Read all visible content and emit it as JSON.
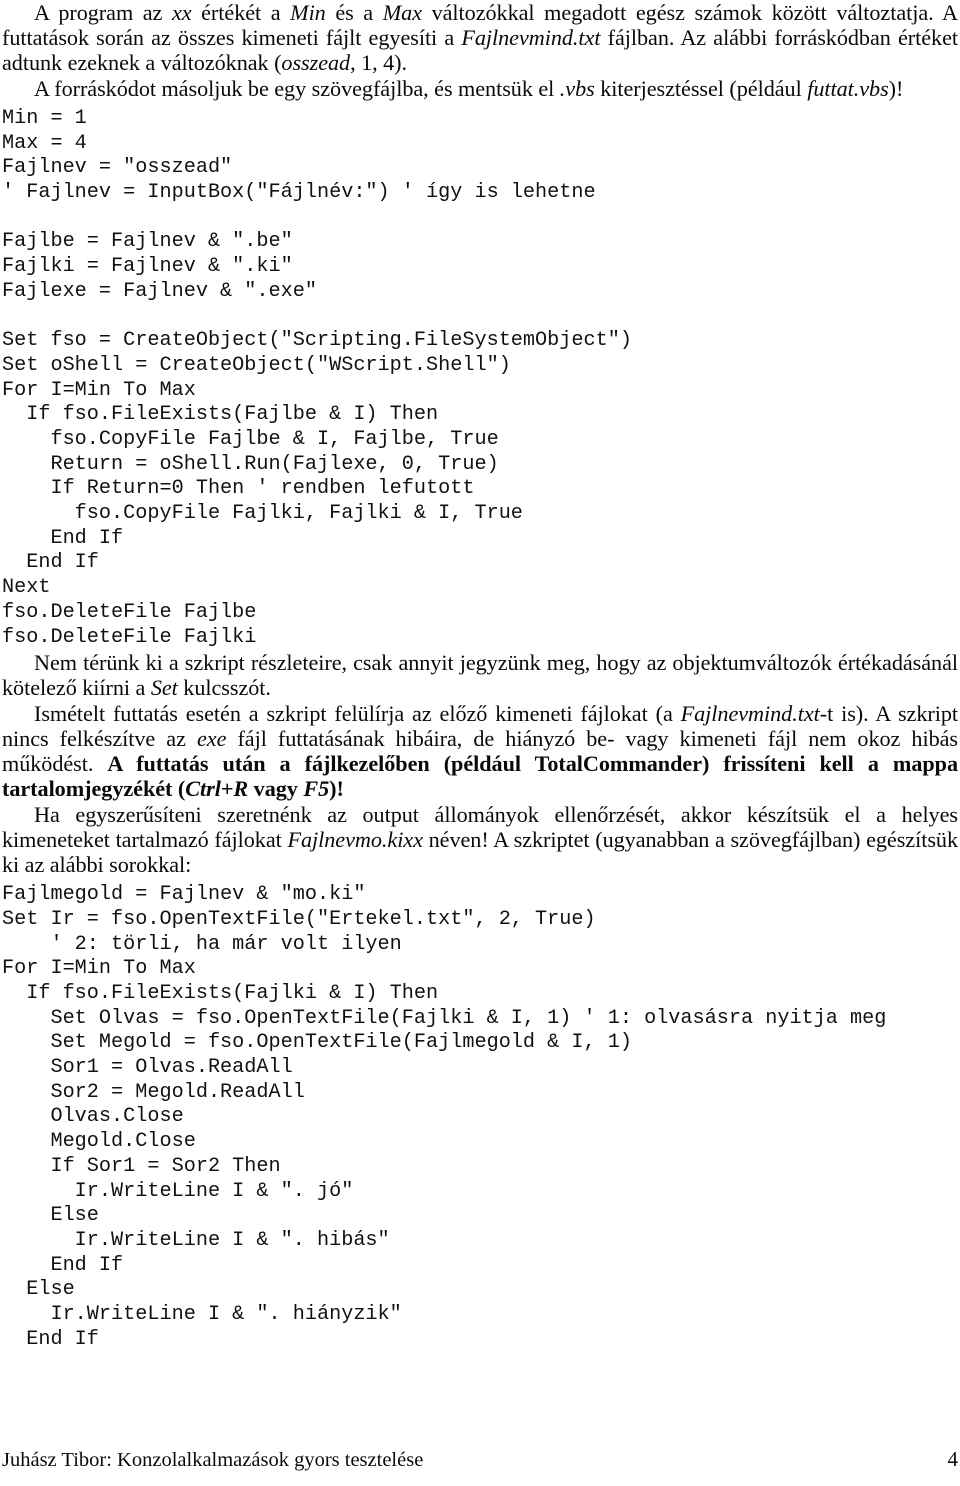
{
  "document": {
    "language": "hu",
    "paragraphs": {
      "intro": {
        "segments": [
          {
            "text": "A program az ",
            "style": "normal"
          },
          {
            "text": "xx",
            "style": "italic"
          },
          {
            "text": " értékét a ",
            "style": "normal"
          },
          {
            "text": "Min",
            "style": "italic"
          },
          {
            "text": " és a ",
            "style": "normal"
          },
          {
            "text": "Max",
            "style": "italic"
          },
          {
            "text": " változókkal megadott egész számok között változtatja. A futtatások során az összes kimeneti fájlt egyesíti a ",
            "style": "normal"
          },
          {
            "text": "Fajlnevmind.txt",
            "style": "italic"
          },
          {
            "text": " fájlban. Az alábbi forráskódban értéket adtunk ezeknek a változóknak (",
            "style": "normal"
          },
          {
            "text": "osszead",
            "style": "italic"
          },
          {
            "text": ", 1, 4).",
            "style": "normal"
          }
        ],
        "plain": "A program az xx értékét a Min és a Max változókkal megadott egész számok között változtatja. A futtatások során az összes kimeneti fájlt egyesíti a Fajlnevmind.txt fájlban. Az alábbi forráskódban értéket adtunk ezeknek a változóknak (osszead, 1, 4)."
      },
      "save_instruction": {
        "plain": "A forráskódot másoljuk be egy szövegfájlba, és mentsük el .vbs kiterjesztéssel (például futtat.vbs)!"
      },
      "set_keyword": {
        "plain": "Nem térünk ki a szkript részleteire, csak annyit jegyzünk meg, hogy az objektumváltozók értékadásánál kötelező kiírni a Set kulcsszót."
      },
      "repeat_run": {
        "plain": "Ismételt futtatás esetén a szkript felülírja az előző kimeneti fájlokat (a Fajlnevmind.txt-t is). A szkript nincs felkészítve az exe fájl futtatásának hibáira, de hiányzó be- vagy kimeneti fájl nem okoz hibás működést. A futtatás után a fájlkezelőben (például TotalCommander) frissíteni kell a mappa tartalomjegyzékét (Ctrl+R vagy F5)!"
      },
      "simplify": {
        "plain": "Ha egyszerűsíteni szeretnénk az output állományok ellenőrzését, akkor készítsük el a helyes kimeneteket tartalmazó fájlokat Fajlnevmo.kixx néven! A szkriptet (ugyanabban a szövegfájlban) egészítsük ki az alábbi sorokkal:"
      }
    },
    "code_block_1": "Min = 1\nMax = 4\nFajlnev = \"osszead\"\n' Fajlnev = InputBox(\"Fájlnév:\") ' így is lehetne\n\nFajlbe = Fajlnev & \".be\"\nFajlki = Fajlnev & \".ki\"\nFajlexe = Fajlnev & \".exe\"\n\nSet fso = CreateObject(\"Scripting.FileSystemObject\")\nSet oShell = CreateObject(\"WScript.Shell\")\nFor I=Min To Max\n  If fso.FileExists(Fajlbe & I) Then\n    fso.CopyFile Fajlbe & I, Fajlbe, True\n    Return = oShell.Run(Fajlexe, 0, True)\n    If Return=0 Then ' rendben lefutott\n      fso.CopyFile Fajlki, Fajlki & I, True\n    End If\n  End If\nNext\nfso.DeleteFile Fajlbe\nfso.DeleteFile Fajlki",
    "code_block_2": "Fajlmegold = Fajlnev & \"mo.ki\"\nSet Ir = fso.OpenTextFile(\"Ertekel.txt\", 2, True)\n    ' 2: törli, ha már volt ilyen\nFor I=Min To Max\n  If fso.FileExists(Fajlki & I) Then\n    Set Olvas = fso.OpenTextFile(Fajlki & I, 1) ' 1: olvasásra nyitja meg\n    Set Megold = fso.OpenTextFile(Fajlmegold & I, 1)\n    Sor1 = Olvas.ReadAll\n    Sor2 = Megold.ReadAll\n    Olvas.Close\n    Megold.Close\n    If Sor1 = Sor2 Then\n      Ir.WriteLine I & \". jó\"\n    Else\n      Ir.WriteLine I & \". hibás\"\n    End If\n  Else\n    Ir.WriteLine I & \". hiányzik\"\n  End If",
    "footer": {
      "title": "Juhász Tibor: Konzolalkalmazások gyors tesztelése",
      "page_number": "4"
    }
  }
}
